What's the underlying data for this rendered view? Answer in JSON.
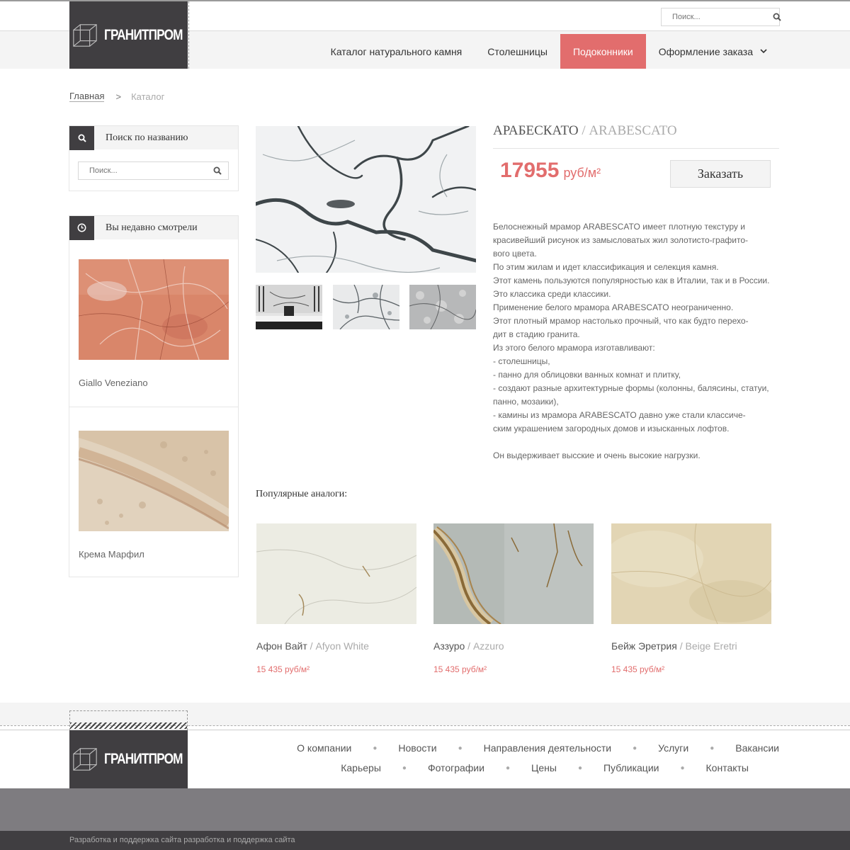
{
  "brand": {
    "logo_text": "ГРАНИТПРОМ"
  },
  "header": {
    "search_placeholder": "Поиск...",
    "menu": [
      {
        "label": "Каталог натурального камня"
      },
      {
        "label": "Столешницы"
      },
      {
        "label": "Подоконники"
      },
      {
        "label": "Оформление заказа"
      }
    ]
  },
  "breadcrumb": {
    "home": "Главная",
    "separator": ">",
    "current": "Каталог"
  },
  "sidebar": {
    "search": {
      "title": "Поиск по названию",
      "placeholder": "Поиск..."
    },
    "recent": {
      "title": "Вы недавно смотрели",
      "items": [
        {
          "name": "Giallo Veneziano"
        },
        {
          "name": "Крема Марфил"
        }
      ]
    }
  },
  "product": {
    "title_ru": "АРАБЕСКАТО",
    "title_sep": " / ",
    "title_lat": "ARABESCATO",
    "price": "17955",
    "price_unit": "руб/м²",
    "order_label": "Заказать",
    "description": [
      "Белоснежный мрамор ARABESCATO имеет плотную текстуру и красивейший рисунок из замысловатых жил золотисто-графито-\nвого цвета.\nПо этим жилам и идет классификация и селекция камня.\nЭтот камень пользуются популярностью как в Италии, так и в России. Это классика среди классики.\nПрименение белого мрамора ARABESCATO неограниченно.\nЭтот плотный мрамор настолько прочный, что как будто перехо-\nдит в стадию гранита.\nИз этого белого мрамора изготавливают:\n- столешницы,\n- панно для облицовки ванных комнат и плитку,\n- создают разные архитектурные формы (колонны, балясины, статуи, панно, мозаики),\n- камины из мрамора ARABESCATO давно уже стали классиче-\nским украшением загородных домов и изысканных лофтов.",
      "Он выдерживает высские и очень высокие нагрузки."
    ]
  },
  "analogs": {
    "title": "Популярные аналоги:",
    "items": [
      {
        "name_ru": "Афон Вайт",
        "name_lat": "Afyon White",
        "price": "15 435 руб/м²"
      },
      {
        "name_ru": "Аззуро",
        "name_lat": "Azzuro",
        "price": "15 435 руб/м²"
      },
      {
        "name_ru": "Бейж Эретрия",
        "name_lat": "Beige Eretri",
        "price": "15 435 руб/м²"
      }
    ]
  },
  "footer": {
    "links_row1": [
      "О компании",
      "Новости",
      "Направления деятельности",
      "Услуги",
      "Вакансии"
    ],
    "links_row2": [
      "Карьеры",
      "Фотографии",
      "Цены",
      "Публикации",
      "Контакты"
    ],
    "credit": "Разработка и поддержка сайта разработка и поддержка сайта"
  },
  "colors": {
    "accent": "#e26d6d",
    "dark": "#403e41",
    "light_bg": "#f4f4f4",
    "band": "#7e7c80"
  },
  "icons": [
    "search-icon",
    "clock-icon",
    "chevron-down-icon",
    "cube-logo-icon"
  ]
}
